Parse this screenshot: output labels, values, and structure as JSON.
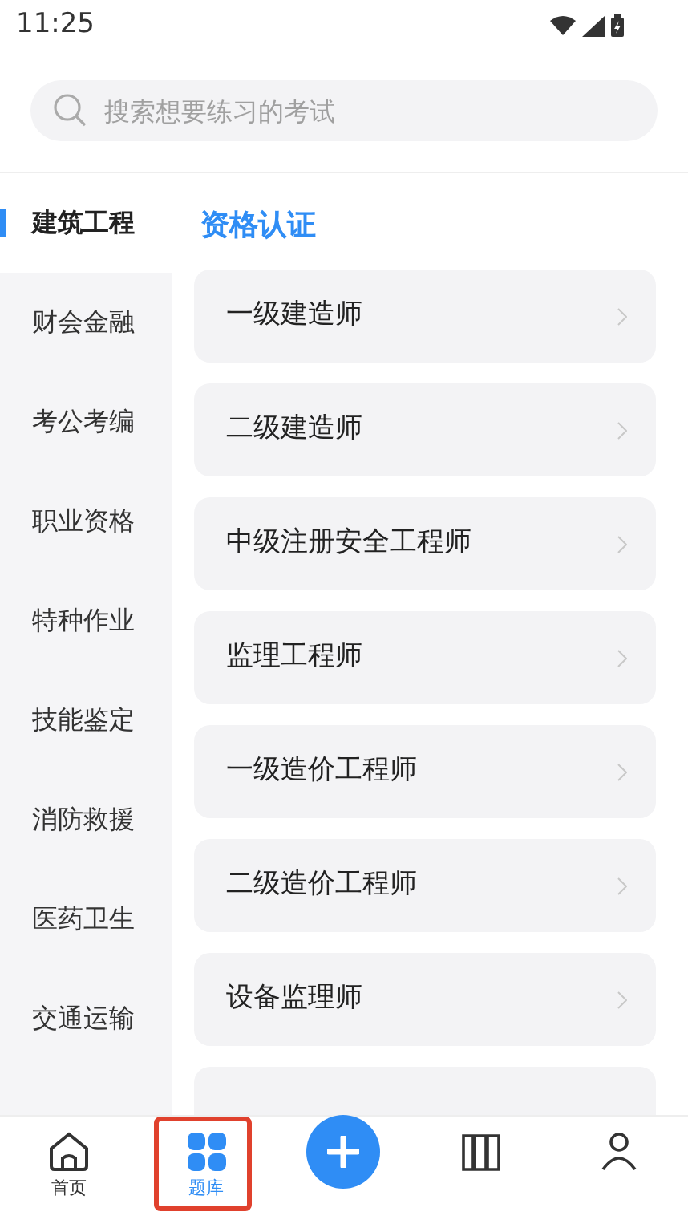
{
  "status_bar": {
    "time": "11:25"
  },
  "search": {
    "placeholder": "搜索想要练习的考试"
  },
  "sidebar": {
    "items": [
      {
        "label": "建筑工程",
        "selected": true
      },
      {
        "label": "财会金融",
        "selected": false
      },
      {
        "label": "考公考编",
        "selected": false
      },
      {
        "label": "职业资格",
        "selected": false
      },
      {
        "label": "特种作业",
        "selected": false
      },
      {
        "label": "技能鉴定",
        "selected": false
      },
      {
        "label": "消防救援",
        "selected": false
      },
      {
        "label": "医药卫生",
        "selected": false
      },
      {
        "label": "交通运输",
        "selected": false
      }
    ]
  },
  "section": {
    "title": "资格认证",
    "items": [
      "一级建造师",
      "二级建造师",
      "中级注册安全工程师",
      "监理工程师",
      "一级造价工程师",
      "二级造价工程师",
      "设备监理师"
    ]
  },
  "tab_bar": {
    "items": [
      {
        "kind": "home",
        "label": "首页",
        "selected": false
      },
      {
        "kind": "grid",
        "label": "题库",
        "selected": true
      },
      {
        "kind": "plus"
      },
      {
        "kind": "book"
      },
      {
        "kind": "person"
      }
    ]
  }
}
